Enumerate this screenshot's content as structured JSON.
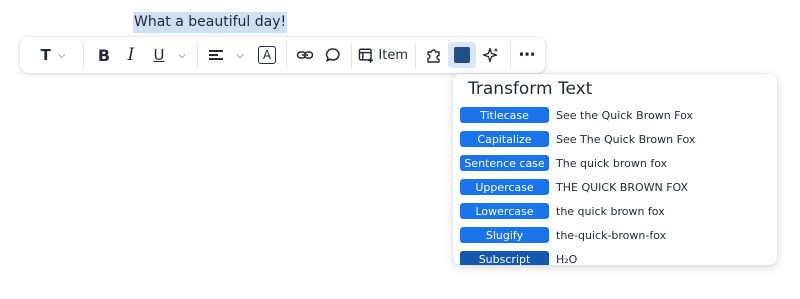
{
  "editor": {
    "selected_text": "What a beautiful day!"
  },
  "toolbar": {
    "text_style_icon": "T",
    "item_label": "Item",
    "highlight_color": "#1f4f86",
    "more_icon": "⋯"
  },
  "transform_panel": {
    "title": "Transform Text",
    "rows": [
      {
        "label": "Titlecase",
        "example": "See the Quick Brown Fox"
      },
      {
        "label": "Capitalize",
        "example": "See The Quick Brown Fox"
      },
      {
        "label": "Sentence case",
        "example": "The quick brown fox"
      },
      {
        "label": "Uppercase",
        "example": "THE QUICK BROWN FOX"
      },
      {
        "label": "Lowercase",
        "example": "the quick brown fox"
      },
      {
        "label": "Slugify",
        "example": "the-quick-brown-fox"
      },
      {
        "label": "Subscript",
        "example": "H₂O"
      }
    ]
  },
  "colors": {
    "accent": "#1a73e8",
    "selection": "#cfe0f5"
  }
}
